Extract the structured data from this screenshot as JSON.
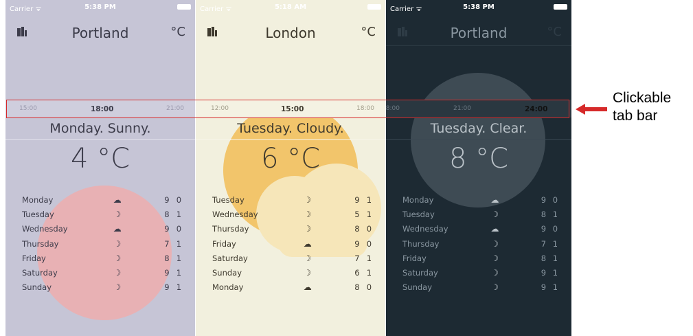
{
  "screens": [
    {
      "status": {
        "carrier": "Carrier ᯤ",
        "time": "5:38 PM"
      },
      "city_icon": "building-icon",
      "city": "Portland",
      "unit": "°C",
      "tabs": [
        {
          "label": "15:00",
          "active": false
        },
        {
          "label": "18:00",
          "active": true
        },
        {
          "label": "21:00",
          "active": false
        }
      ],
      "summary": "Monday. Sunny.",
      "temperature": "4 °C",
      "forecast": [
        {
          "day": "Monday",
          "icon": "cloud-icon",
          "high": "9",
          "low": "0"
        },
        {
          "day": "Tuesday",
          "icon": "moon-icon",
          "high": "8",
          "low": "1"
        },
        {
          "day": "Wednesday",
          "icon": "cloud-icon",
          "high": "9",
          "low": "0"
        },
        {
          "day": "Thursday",
          "icon": "moon-icon",
          "high": "7",
          "low": "1"
        },
        {
          "day": "Friday",
          "icon": "moon-icon",
          "high": "8",
          "low": "1"
        },
        {
          "day": "Saturday",
          "icon": "moon-icon",
          "high": "9",
          "low": "1"
        },
        {
          "day": "Sunday",
          "icon": "moon-icon",
          "high": "9",
          "low": "1"
        }
      ],
      "colors": {
        "background": "#c6c5d6",
        "decoration": "#e8b1b4"
      }
    },
    {
      "status": {
        "carrier": "Carrier ᯤ",
        "time": "5:18 AM"
      },
      "city_icon": "building-icon",
      "city": "London",
      "unit": "°C",
      "tabs": [
        {
          "label": "12:00",
          "active": false
        },
        {
          "label": "15:00",
          "active": true
        },
        {
          "label": "18:00",
          "active": false
        }
      ],
      "summary": "Tuesday. Cloudy.",
      "temperature": "6 °C",
      "forecast": [
        {
          "day": "Tuesday",
          "icon": "moon-icon",
          "high": "9",
          "low": "1"
        },
        {
          "day": "Wednesday",
          "icon": "moon-icon",
          "high": "5",
          "low": "1"
        },
        {
          "day": "Thursday",
          "icon": "moon-icon",
          "high": "8",
          "low": "0"
        },
        {
          "day": "Friday",
          "icon": "cloud-icon",
          "high": "9",
          "low": "0"
        },
        {
          "day": "Saturday",
          "icon": "moon-icon",
          "high": "7",
          "low": "1"
        },
        {
          "day": "Sunday",
          "icon": "moon-icon",
          "high": "6",
          "low": "1"
        },
        {
          "day": "Monday",
          "icon": "cloud-icon",
          "high": "8",
          "low": "0"
        }
      ],
      "colors": {
        "background": "#f2f0de",
        "decoration": "#f2c56b"
      }
    },
    {
      "status": {
        "carrier": "Carrier ᯤ",
        "time": "5:38 PM"
      },
      "city_icon": "building-icon",
      "city": "Portland",
      "unit": "°C",
      "tabs": [
        {
          "label": "18:00",
          "active": false
        },
        {
          "label": "21:00",
          "active": false
        },
        {
          "label": "24:00",
          "active": true
        }
      ],
      "summary": "Tuesday. Clear.",
      "temperature": "8 °C",
      "forecast": [
        {
          "day": "Monday",
          "icon": "cloud-icon",
          "high": "9",
          "low": "0"
        },
        {
          "day": "Tuesday",
          "icon": "moon-icon",
          "high": "8",
          "low": "1"
        },
        {
          "day": "Wednesday",
          "icon": "cloud-icon",
          "high": "9",
          "low": "0"
        },
        {
          "day": "Thursday",
          "icon": "moon-icon",
          "high": "7",
          "low": "1"
        },
        {
          "day": "Friday",
          "icon": "moon-icon",
          "high": "8",
          "low": "1"
        },
        {
          "day": "Saturday",
          "icon": "moon-icon",
          "high": "9",
          "low": "1"
        },
        {
          "day": "Sunday",
          "icon": "moon-icon",
          "high": "9",
          "low": "1"
        }
      ],
      "colors": {
        "background": "#1d2a33",
        "decoration": "#3e4b54"
      }
    }
  ],
  "callout": {
    "text_line1": "Clickable",
    "text_line2": "tab bar",
    "color": "#d62a2a"
  }
}
